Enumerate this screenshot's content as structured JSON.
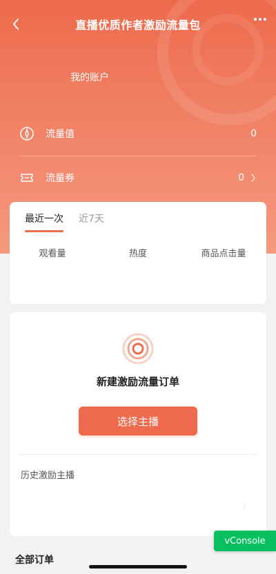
{
  "navbar": {
    "title": "直播优质作者激励流量包",
    "back_icon": "chevron-left-icon",
    "more_icon": "more-dots-icon"
  },
  "account": {
    "label": "我的账户"
  },
  "metrics": [
    {
      "icon": "flow-value-icon",
      "label": "流量值",
      "value": "0"
    },
    {
      "icon": "coupon-icon",
      "label": "流量券",
      "value": "0"
    }
  ],
  "stats_card": {
    "tabs": [
      {
        "label": "最近一次",
        "active": true
      },
      {
        "label": "近7天",
        "active": false
      }
    ],
    "columns": [
      "观看量",
      "热度",
      "商品点击量"
    ]
  },
  "order_card": {
    "title": "新建激励流量订单",
    "button_label": "选择主播",
    "history_label": "历史激励主播"
  },
  "all_orders_label": "全部订单",
  "vconsole_label": "vConsole",
  "colors": {
    "primary": "#ee6a4d",
    "vconsole": "#07c160"
  }
}
